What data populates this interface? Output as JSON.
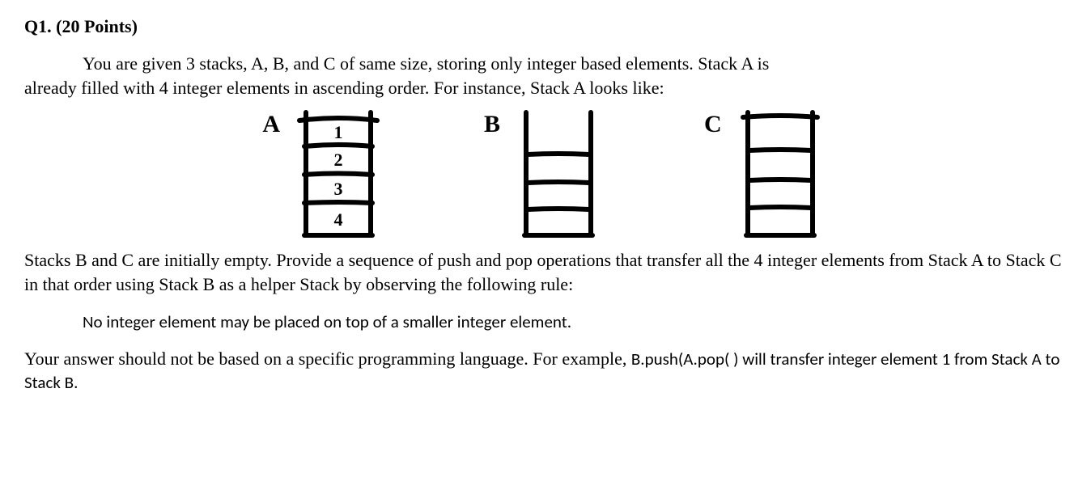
{
  "heading": "Q1.  (20 Points)",
  "p1a": "You are given 3 stacks, A, B, and C of same size, storing only integer based elements. Stack A is",
  "p1b": "already filled with 4 integer elements in ascending order. For instance, Stack A looks like:",
  "stacks": {
    "A": {
      "label": "A",
      "values": [
        "1",
        "2",
        "3",
        "4"
      ]
    },
    "B": {
      "label": "B",
      "values": []
    },
    "C": {
      "label": "C",
      "values": []
    }
  },
  "p2": "Stacks B and C are initially empty. Provide a sequence of push and pop operations that transfer all the 4 integer elements from Stack A to Stack C in that order using Stack B as a helper Stack by observing the following rule:",
  "rule": "No integer element may be placed on top of a smaller integer element.",
  "p3a": "Your answer should not be based on a specific programming language. For example, ",
  "p3b": "B.push(A.pop( ) will transfer integer element 1 from Stack A to Stack B."
}
